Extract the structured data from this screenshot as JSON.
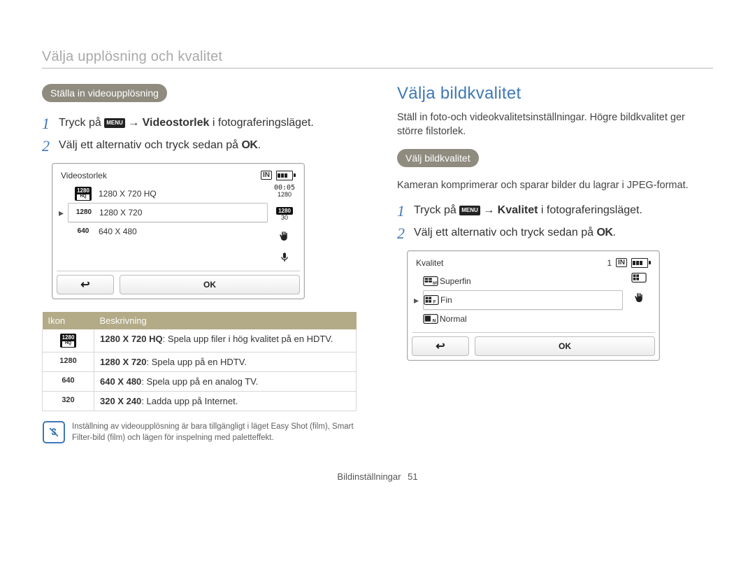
{
  "page_title": "Välja upplösning och kvalitet",
  "left": {
    "pill": "Ställa in videoupplösning",
    "step1_pre": "Tryck på ",
    "step1_menu": "MENU",
    "step1_arrow": "→",
    "step1_bold": "Videostorlek",
    "step1_post": " i fotograferingsläget.",
    "step2": "Välj ett alternativ och tryck sedan på ",
    "ok_label": "OK",
    "dot": "."
  },
  "lcd_video": {
    "title": "Videostorlek",
    "timer": "00:05",
    "side_res": "1280",
    "side_fps_top": "1280",
    "side_fps_bot": "30",
    "options": [
      {
        "badge_top": "1280",
        "badge_sub": "HQ",
        "label": "1280 X 720 HQ",
        "selected": false
      },
      {
        "badge_top": "1280",
        "label": "1280 X 720",
        "selected": true
      },
      {
        "badge_top": "640",
        "label": "640 X 480",
        "selected": false
      }
    ],
    "back": "↩",
    "ok": "OK"
  },
  "table": {
    "h_icon": "Ikon",
    "h_desc": "Beskrivning",
    "rows": [
      {
        "icon_top": "1280",
        "icon_sub": "HQ",
        "bold": "1280 X 720 HQ",
        "text": ": Spela upp filer i hög kvalitet på en HDTV."
      },
      {
        "icon_plain": "1280",
        "bold": "1280 X 720",
        "text": ": Spela upp på en HDTV."
      },
      {
        "icon_plain": "640",
        "bold": "640 X 480",
        "text": ": Spela upp på en analog TV."
      },
      {
        "icon_plain": "320",
        "bold": "320 X 240",
        "text": ": Ladda upp på Internet."
      }
    ]
  },
  "tip": "Inställning av videoupplösning är bara tillgängligt i läget Easy Shot (film), Smart Filter-bild (film) och lägen för inspelning med paletteffekt.",
  "right": {
    "heading": "Välja bildkvalitet",
    "intro": "Ställ in foto-och videokvalitetsinställningar. Högre bildkvalitet ger större filstorlek.",
    "pill": "Välj bildkvalitet",
    "sub": "Kameran komprimerar och sparar bilder du lagrar i JPEG-format.",
    "step1_pre": "Tryck på ",
    "step1_menu": "MENU",
    "step1_arrow": "→",
    "step1_bold": "Kvalitet",
    "step1_post": " i fotograferingsläget.",
    "step2": "Välj ett alternativ och tryck sedan på ",
    "ok_label": "OK",
    "dot": "."
  },
  "lcd_quality": {
    "title": "Kvalitet",
    "count": "1",
    "options": [
      {
        "q": "SF",
        "label": "Superfin",
        "selected": false
      },
      {
        "q": "F",
        "label": "Fin",
        "selected": true
      },
      {
        "q": "N",
        "label": "Normal",
        "selected": false
      }
    ],
    "back": "↩",
    "ok": "OK"
  },
  "footer": {
    "section": "Bildinställningar",
    "page": "51"
  }
}
